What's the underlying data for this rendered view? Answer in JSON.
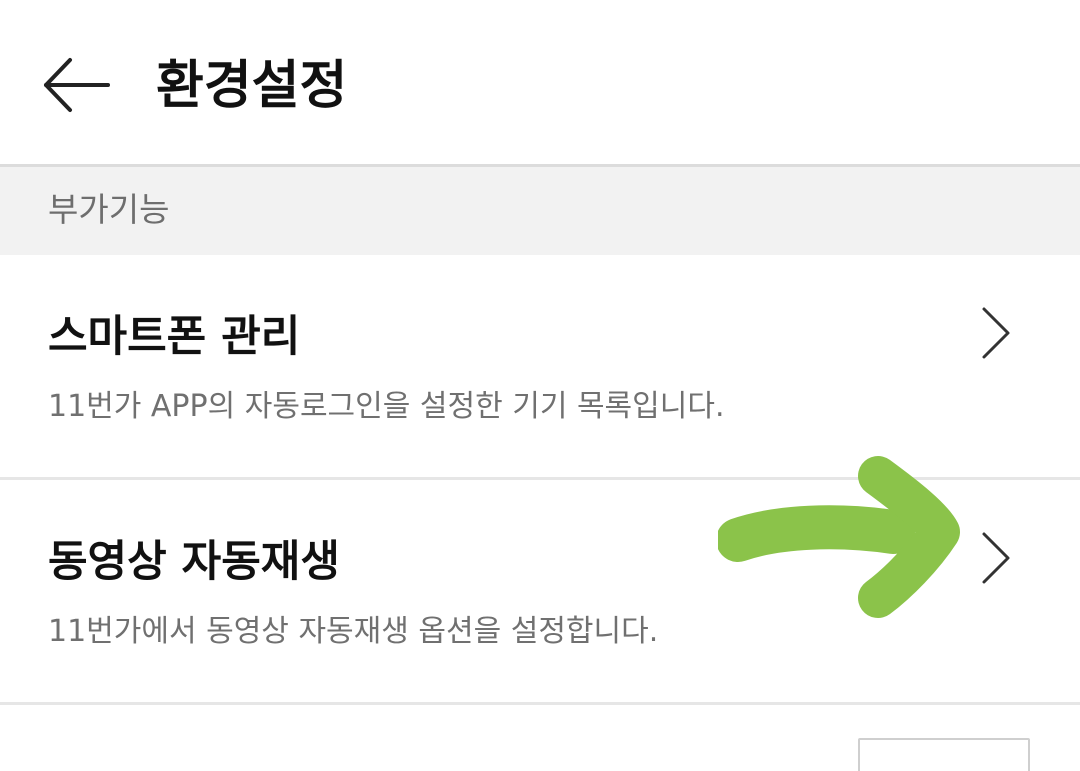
{
  "header": {
    "title": "환경설정",
    "back_icon": "arrow-left-icon"
  },
  "section": {
    "label": "부가기능"
  },
  "rows": [
    {
      "title": "스마트폰 관리",
      "description": "11번가 APP의 자동로그인을 설정한 기기 목록입니다.",
      "icon": "chevron-right-icon"
    },
    {
      "title": "동영상 자동재생",
      "description": "11번가에서 동영상 자동재생 옵션을 설정합니다.",
      "icon": "chevron-right-icon"
    }
  ],
  "annotation": {
    "icon": "green-arrow-icon",
    "color": "#8bc34a"
  },
  "colors": {
    "section_bg": "#f2f2f2",
    "divider": "#dcdcdc",
    "title_text": "#111111",
    "desc_text": "#707070"
  }
}
